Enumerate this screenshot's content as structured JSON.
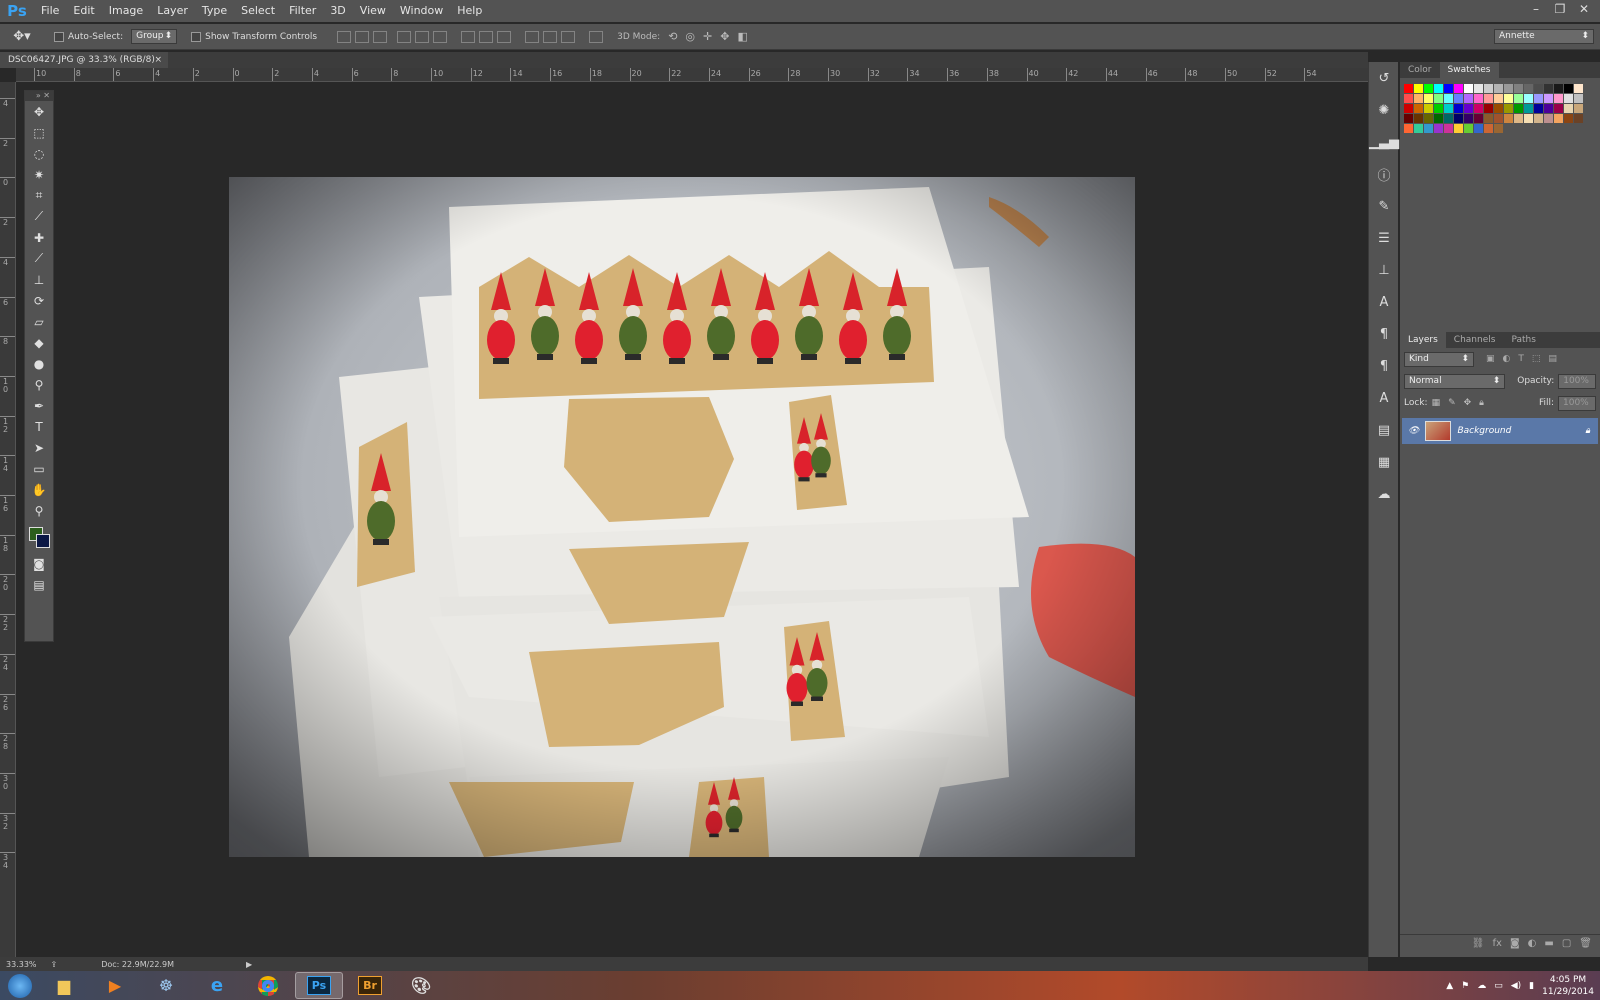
{
  "menubar": {
    "logo": "Ps",
    "items": [
      "File",
      "Edit",
      "Image",
      "Layer",
      "Type",
      "Select",
      "Filter",
      "3D",
      "View",
      "Window",
      "Help"
    ]
  },
  "options": {
    "auto_select_label": "Auto-Select:",
    "auto_select_value": "Group",
    "transform_label": "Show Transform Controls",
    "mode_label": "3D Mode:",
    "workspace": "Annette"
  },
  "document": {
    "tab_title": "DSC06427.JPG @ 33.3% (RGB/8)",
    "close": "×"
  },
  "rulers": {
    "h_labels": [
      "10",
      "8",
      "6",
      "4",
      "2",
      "0",
      "2",
      "4",
      "6",
      "8",
      "10",
      "12",
      "14",
      "16",
      "18",
      "20",
      "22",
      "24",
      "26",
      "28",
      "30",
      "32",
      "34",
      "36",
      "38",
      "40",
      "42",
      "44",
      "46",
      "48",
      "50",
      "52",
      "54"
    ],
    "v_labels": [
      "4",
      "2",
      "0",
      "2",
      "4",
      "6",
      "8",
      "1\n0",
      "1\n2",
      "1\n4",
      "1\n6",
      "1\n8",
      "2\n0",
      "2\n2",
      "2\n4",
      "2\n6",
      "2\n8",
      "3\n0",
      "3\n2",
      "3\n4"
    ]
  },
  "panels": {
    "top_tabs": [
      "Color",
      "Swatches"
    ],
    "active_top_tab": "Swatches",
    "layer_tabs": [
      "Layers",
      "Channels",
      "Paths"
    ],
    "filter_kind": "Kind",
    "blend_mode": "Normal",
    "opacity_label": "Opacity:",
    "opacity_value": "100%",
    "lock_label": "Lock:",
    "fill_label": "Fill:",
    "fill_value": "100%",
    "layer_name": "Background"
  },
  "swatch_colors": [
    "#ff0000",
    "#ffff00",
    "#00ff00",
    "#00ffff",
    "#0000ff",
    "#ff00ff",
    "#ffffff",
    "#e6e6e6",
    "#cccccc",
    "#b3b3b3",
    "#999999",
    "#808080",
    "#666666",
    "#4d4d4d",
    "#333333",
    "#1a1a1a",
    "#000000",
    "#ffe6cc",
    "#ff4d4d",
    "#ffb366",
    "#ffff66",
    "#80ff80",
    "#66ffff",
    "#6680ff",
    "#b366ff",
    "#ff66cc",
    "#ff9999",
    "#ffcc99",
    "#ffff99",
    "#99ff99",
    "#99ffff",
    "#9999ff",
    "#cc99ff",
    "#ff99cc",
    "#e0e0e0",
    "#c0c0c0",
    "#cc0000",
    "#cc6600",
    "#cccc00",
    "#00cc00",
    "#00cccc",
    "#0000cc",
    "#6600cc",
    "#cc0066",
    "#990000",
    "#994c00",
    "#999900",
    "#009900",
    "#009999",
    "#000099",
    "#4c0099",
    "#990049",
    "#e8d5b0",
    "#c9a77a",
    "#660000",
    "#663300",
    "#666600",
    "#006600",
    "#006666",
    "#000066",
    "#330066",
    "#660033",
    "#8b5a2b",
    "#a0522d",
    "#cd853f",
    "#deb887",
    "#f5deb3",
    "#d2b48c",
    "#bc8f8f",
    "#f4a460",
    "#8b4513",
    "#6b4226",
    "#ff6633",
    "#33cc99",
    "#3399cc",
    "#9933cc",
    "#cc3399",
    "#ffcc33",
    "#66cc33",
    "#3366cc",
    "#cc6633",
    "#996633"
  ],
  "status": {
    "zoom": "33.33%",
    "doc": "Doc: 22.9M/22.9M"
  },
  "taskbar": {
    "apps": [
      "explorer",
      "media",
      "network",
      "ie",
      "chrome",
      "Ps",
      "Br",
      "paint"
    ],
    "ps_label": "Ps",
    "br_label": "Br",
    "time": "4:05 PM",
    "date": "11/29/2014"
  },
  "colors": {
    "fg": "#2c5e1c",
    "bg": "#0b1744",
    "accent": "#3aa3f3"
  }
}
